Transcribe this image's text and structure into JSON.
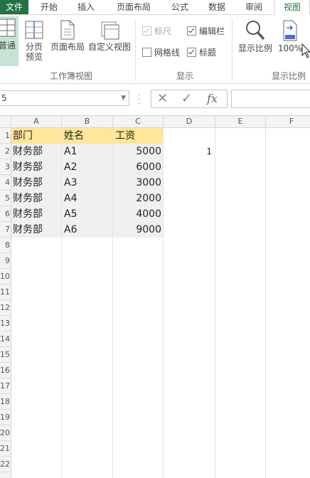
{
  "ribbon_tabs": [
    {
      "label": "文件"
    },
    {
      "label": "开始"
    },
    {
      "label": "插入"
    },
    {
      "label": "页面布局"
    },
    {
      "label": "公式"
    },
    {
      "label": "数据"
    },
    {
      "label": "审阅"
    },
    {
      "label": "视图"
    }
  ],
  "ribbon": {
    "workbook_views": {
      "normal": "普通",
      "page_break": "分页",
      "page_break_line2": "预览",
      "page_layout": "页面布局",
      "custom_views": "自定义视图",
      "label": "工作簿视图"
    },
    "show": {
      "ruler": "标尺",
      "gridlines": "网格线",
      "formula_bar": "编辑栏",
      "headings": "标题",
      "label": "显示",
      "ruler_checked": true,
      "gridlines_checked": false,
      "formula_bar_checked": true,
      "headings_checked": true
    },
    "zoom": {
      "zoom": "显示比例",
      "zoom100": "100%",
      "label": "显示比例"
    }
  },
  "formula_bar": {
    "name_box": "5",
    "fx": "fx",
    "formula": ""
  },
  "columns": [
    "A",
    "B",
    "C",
    "D",
    "E",
    "F"
  ],
  "rows": [
    "1",
    "2",
    "3",
    "4",
    "5",
    "6",
    "7",
    "8",
    "9",
    "10",
    "11",
    "12",
    "13",
    "14",
    "15",
    "16",
    "17",
    "18",
    "19",
    "20",
    "21",
    "22"
  ],
  "table": {
    "headers": [
      "部门",
      "姓名",
      "工资"
    ],
    "rows": [
      [
        "财务部",
        "A1",
        "5000"
      ],
      [
        "财务部",
        "A2",
        "6000"
      ],
      [
        "财务部",
        "A3",
        "3000"
      ],
      [
        "财务部",
        "A4",
        "2000"
      ],
      [
        "财务部",
        "A5",
        "4000"
      ],
      [
        "财务部",
        "A6",
        "9000"
      ]
    ]
  },
  "extra_cells": {
    "d2": "1"
  },
  "colors": {
    "excel_green": "#217346",
    "header_fill": "#ffe699"
  }
}
